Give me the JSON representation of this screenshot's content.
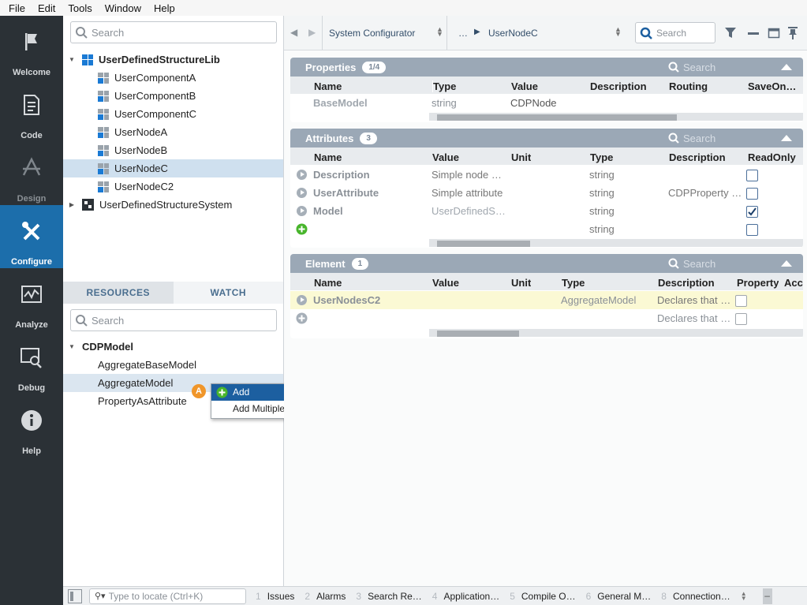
{
  "menu": [
    "File",
    "Edit",
    "Tools",
    "Window",
    "Help"
  ],
  "nav": [
    {
      "label": "Welcome",
      "icon": "flag-icon"
    },
    {
      "label": "Code",
      "icon": "document-icon"
    },
    {
      "label": "Design",
      "icon": "design-icon"
    },
    {
      "label": "Configure",
      "icon": "tools-icon"
    },
    {
      "label": "Analyze",
      "icon": "chart-icon"
    },
    {
      "label": "Debug",
      "icon": "debug-icon"
    },
    {
      "label": "Help",
      "icon": "info-icon"
    }
  ],
  "project": {
    "search_placeholder": "Search",
    "root": "UserDefinedStructureLib",
    "children": [
      "UserComponentA",
      "UserComponentB",
      "UserComponentC",
      "UserNodeA",
      "UserNodeB",
      "UserNodeC",
      "UserNodeC2"
    ],
    "root2": "UserDefinedStructureSystem"
  },
  "resources": {
    "tab_resources": "RESOURCES",
    "tab_watch": "WATCH",
    "search_placeholder": "Search",
    "root": "CDPModel",
    "items": [
      "AggregateBaseModel",
      "AggregateModel",
      "PropertyAsAttribute"
    ]
  },
  "context_menu": {
    "badge": "A",
    "add": "Add",
    "add_multiple": "Add Multiple..."
  },
  "toolbar": {
    "configurator": "System Configurator",
    "ellipsis": "…",
    "node": "UserNodeC",
    "search_placeholder": "Search"
  },
  "properties": {
    "title": "Properties",
    "count": "1/4",
    "search": "Search",
    "headers": [
      "Name",
      "Type",
      "Value",
      "Description",
      "Routing",
      "SaveOnChange"
    ],
    "rows": [
      {
        "name": "BaseModel",
        "type": "string",
        "value": "CDPNode"
      }
    ]
  },
  "attributes": {
    "title": "Attributes",
    "count": "3",
    "search": "Search",
    "headers": [
      "Name",
      "Value",
      "Unit",
      "Type",
      "Description",
      "ReadOnly"
    ],
    "rows": [
      {
        "name": "Description",
        "value": "Simple node …",
        "type": "string",
        "description": "",
        "readonly": false
      },
      {
        "name": "UserAttribute",
        "value": "Simple attribute",
        "type": "string",
        "description": "CDPProperty …",
        "readonly": false
      },
      {
        "name": "Model",
        "value": "UserDefinedS…",
        "type": "string",
        "description": "",
        "readonly": true
      },
      {
        "name": "",
        "value": "",
        "type": "string",
        "description": "",
        "readonly": false
      }
    ]
  },
  "element": {
    "title": "Element",
    "count": "1",
    "search": "Search",
    "headers": [
      "Name",
      "Value",
      "Unit",
      "Type",
      "Description",
      "Property",
      "Acc"
    ],
    "rows": [
      {
        "name": "UserNodesC2",
        "type": "AggregateModel",
        "description": "Declares that …"
      },
      {
        "name": "",
        "type": "",
        "description": "Declares that …"
      }
    ]
  },
  "statusbar": {
    "locate_placeholder": "Type to locate (Ctrl+K)",
    "panes": [
      {
        "num": "1",
        "label": "Issues"
      },
      {
        "num": "2",
        "label": "Alarms"
      },
      {
        "num": "3",
        "label": "Search Re…"
      },
      {
        "num": "4",
        "label": "Application…"
      },
      {
        "num": "5",
        "label": "Compile O…"
      },
      {
        "num": "6",
        "label": "General M…"
      },
      {
        "num": "8",
        "label": "Connection…"
      }
    ]
  },
  "colors": {
    "accent": "#1c6eab",
    "nav_bg": "#2b3136",
    "section_header": "#9ba8b6",
    "highlight_row": "#fbf9d4",
    "badge": "#f0962a"
  }
}
